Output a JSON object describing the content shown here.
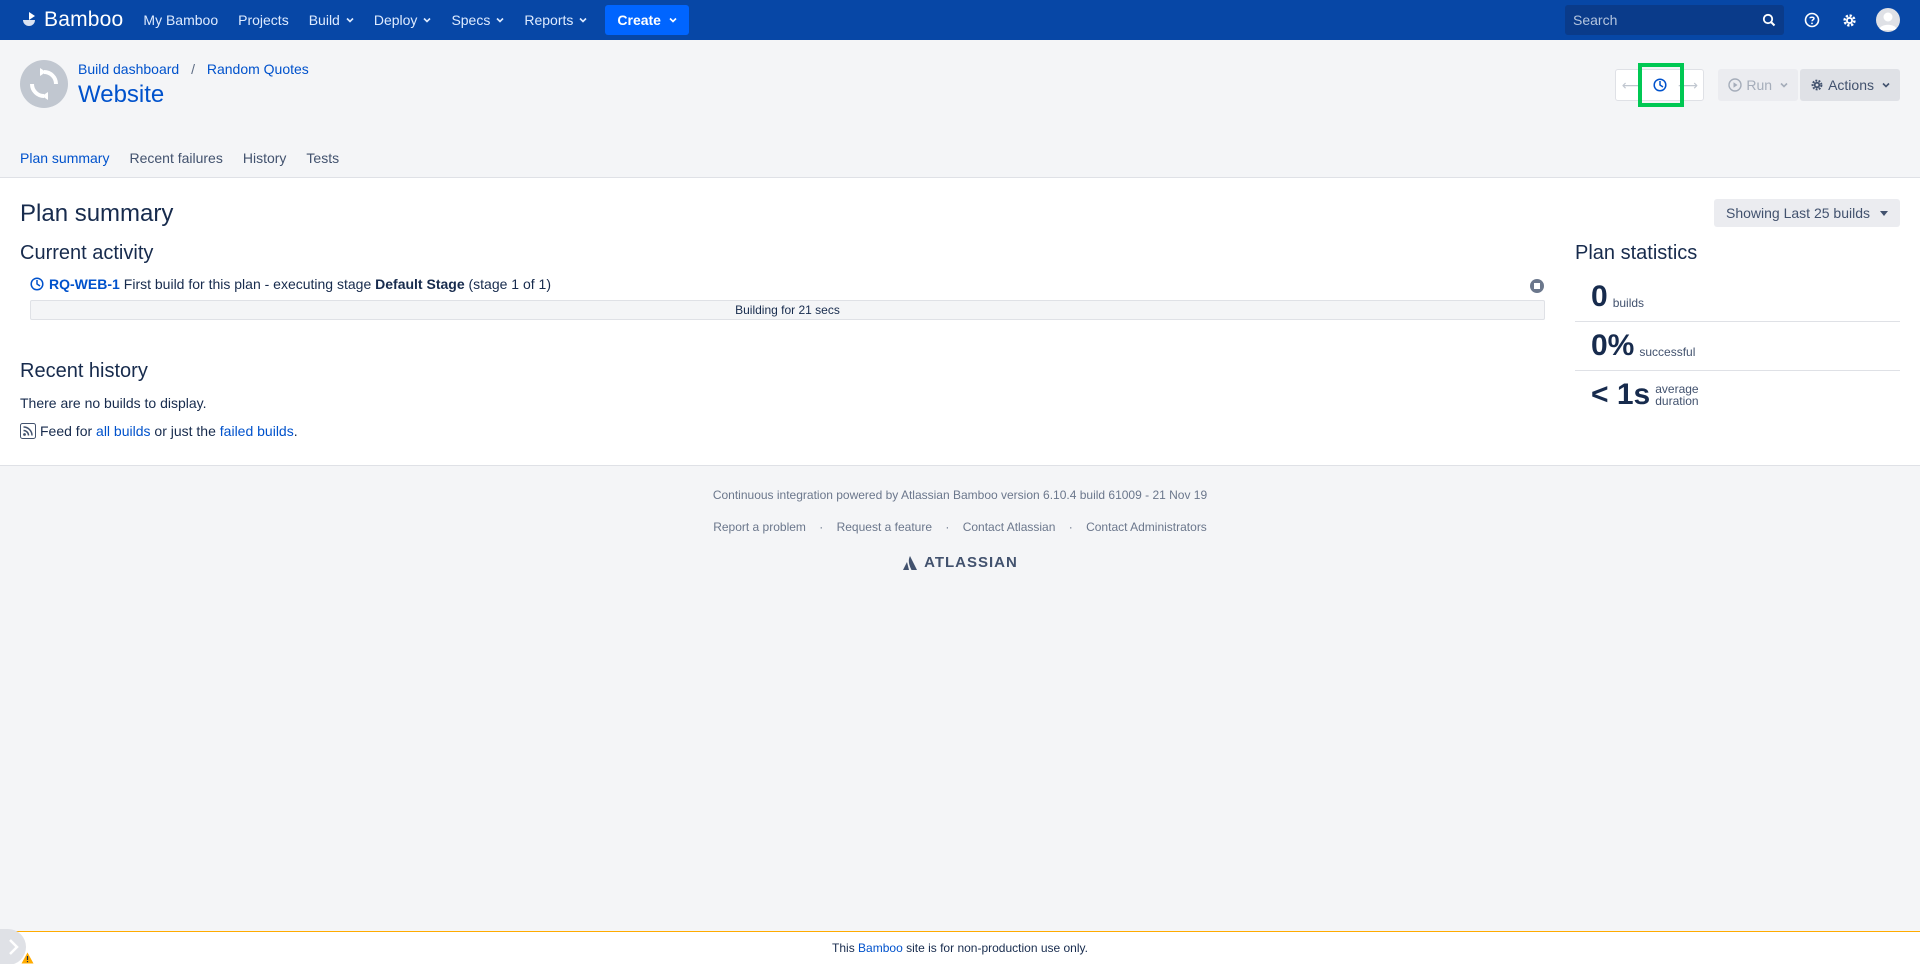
{
  "nav": {
    "logo": "Bamboo",
    "items": [
      {
        "label": "My Bamboo",
        "dropdown": false
      },
      {
        "label": "Projects",
        "dropdown": false
      },
      {
        "label": "Build",
        "dropdown": true
      },
      {
        "label": "Deploy",
        "dropdown": true
      },
      {
        "label": "Specs",
        "dropdown": true
      },
      {
        "label": "Reports",
        "dropdown": true
      }
    ],
    "create_label": "Create",
    "search_placeholder": "Search"
  },
  "header": {
    "breadcrumbs": [
      "Build dashboard",
      "Random Quotes"
    ],
    "title": "Website",
    "run_label": "Run",
    "actions_label": "Actions"
  },
  "tabs": [
    {
      "label": "Plan summary",
      "active": true
    },
    {
      "label": "Recent failures",
      "active": false
    },
    {
      "label": "History",
      "active": false
    },
    {
      "label": "Tests",
      "active": false
    }
  ],
  "main": {
    "title": "Plan summary",
    "showing_label": "Showing Last 25 builds",
    "current_activity": {
      "heading": "Current activity",
      "build_key": "RQ-WEB-1",
      "text_before": "First build for this plan - executing stage",
      "stage_name": "Default Stage",
      "text_after": "(stage 1 of 1)",
      "progress_label": "Building for 21 secs",
      "progress_fraction": 0
    },
    "recent_history": {
      "heading": "Recent history",
      "empty_text": "There are no builds to display.",
      "feed_prefix": "Feed for",
      "all_builds_link": "all builds",
      "feed_middle": "or just the",
      "failed_builds_link": "failed builds",
      "feed_suffix": "."
    },
    "plan_statistics": {
      "heading": "Plan statistics",
      "stats": [
        {
          "value": "0",
          "label1": "builds",
          "label2": ""
        },
        {
          "value": "0%",
          "label1": "successful",
          "label2": ""
        },
        {
          "value": "< 1s",
          "label1": "average",
          "label2": "duration"
        }
      ]
    }
  },
  "footer": {
    "powered": "Continuous integration powered by Atlassian Bamboo version 6.10.4 build 61009 - 21 Nov 19",
    "links": [
      "Report a problem",
      "Request a feature",
      "Contact Atlassian",
      "Contact Administrators"
    ],
    "separator": "·",
    "atlassian": "ATLASSIAN"
  },
  "banner": {
    "prefix": "This",
    "link": "Bamboo",
    "suffix": "site is for non-production use only."
  },
  "colors": {
    "nav_bg": "#0747a6",
    "accent": "#0052cc",
    "create_bg": "#0065ff",
    "focus_highlight": "#00c853",
    "banner_border": "#ffab00"
  }
}
